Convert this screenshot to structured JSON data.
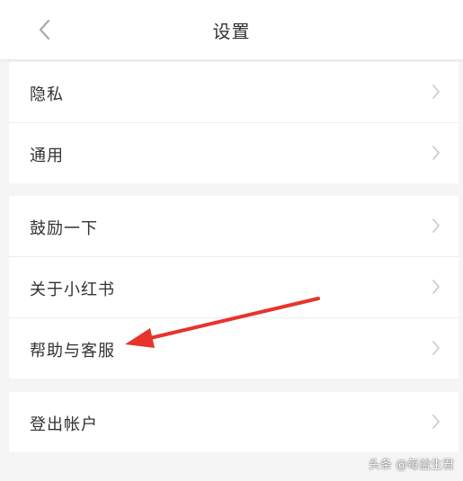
{
  "header": {
    "title": "设置",
    "back_icon": "chevron-left-icon"
  },
  "groups": [
    {
      "items": [
        {
          "label": "隐私"
        },
        {
          "label": "通用"
        }
      ]
    },
    {
      "items": [
        {
          "label": "鼓励一下"
        },
        {
          "label": "关于小红书"
        },
        {
          "label": "帮助与客服"
        }
      ]
    },
    {
      "items": [
        {
          "label": "登出帐户"
        }
      ]
    }
  ],
  "annotation": {
    "type": "arrow",
    "color": "#e8332c",
    "points_to": "帮助与客服"
  },
  "watermark": {
    "text": "头条 @每益生君"
  },
  "colors": {
    "background": "#f5f5f5",
    "card": "#ffffff",
    "text": "#333333",
    "chevron": "#c7c7c7"
  }
}
